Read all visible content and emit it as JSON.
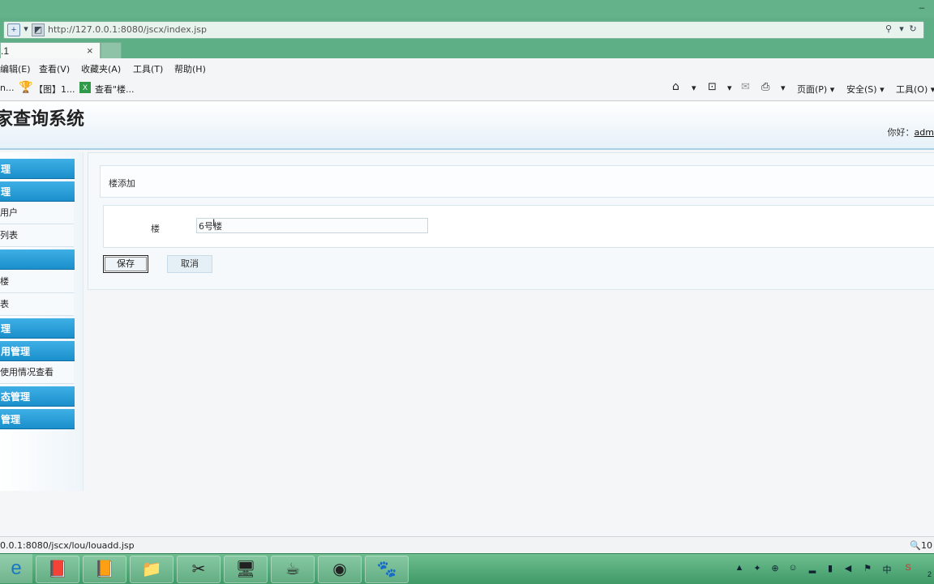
{
  "browser": {
    "url": "http://127.0.0.1:8080/jscx/index.jsp",
    "url_host": "127.0.0.1",
    "tab_title": ".1",
    "tab_close": "×",
    "menu": [
      "编辑(E)",
      "查看(V)",
      "收藏夹(A)",
      "工具(T)",
      "帮助(H)"
    ],
    "favorites": [
      {
        "label": "n...",
        "icon": "page-icon"
      },
      {
        "label": "【图】1...",
        "icon": "trophy-icon"
      },
      {
        "label": "查看\"楼...",
        "icon": "excel-icon"
      }
    ],
    "toolbar": [
      "页面(P)",
      "安全(S)",
      "工具(O)"
    ]
  },
  "header": {
    "title": "家查询系统",
    "greeting": "你好：",
    "user": "adm"
  },
  "sidebar": {
    "items": [
      {
        "type": "head",
        "label": "理"
      },
      {
        "type": "head",
        "label": "理"
      },
      {
        "type": "item",
        "label": "用户"
      },
      {
        "type": "item",
        "label": "列表"
      },
      {
        "type": "head",
        "label": ""
      },
      {
        "type": "item",
        "label": "楼"
      },
      {
        "type": "item",
        "label": "表"
      },
      {
        "type": "head",
        "label": "理"
      },
      {
        "type": "head",
        "label": "用管理"
      },
      {
        "type": "item",
        "label": "使用情况查看"
      },
      {
        "type": "head",
        "label": "态管理"
      },
      {
        "type": "head",
        "label": "管理"
      }
    ]
  },
  "main": {
    "panel_title": "楼添加",
    "field_label": "楼",
    "field_value": "6号楼",
    "save_label": "保存",
    "cancel_label": "取消"
  },
  "status": {
    "url": "0.0.1:8080/jscx/lou/louadd.jsp",
    "zoom": "10"
  },
  "taskbar": {
    "apps": [
      "ie-icon",
      "notebook-icon",
      "book-icon",
      "folder-icon",
      "tools-icon",
      "computer-icon",
      "java-icon",
      "dreamweaver-icon",
      "paw-icon"
    ],
    "clock": "2"
  },
  "colors": {
    "chrome": "#5faf86",
    "sidebar_head": "#1a8fcb",
    "taskbar": "#3f9a66"
  }
}
